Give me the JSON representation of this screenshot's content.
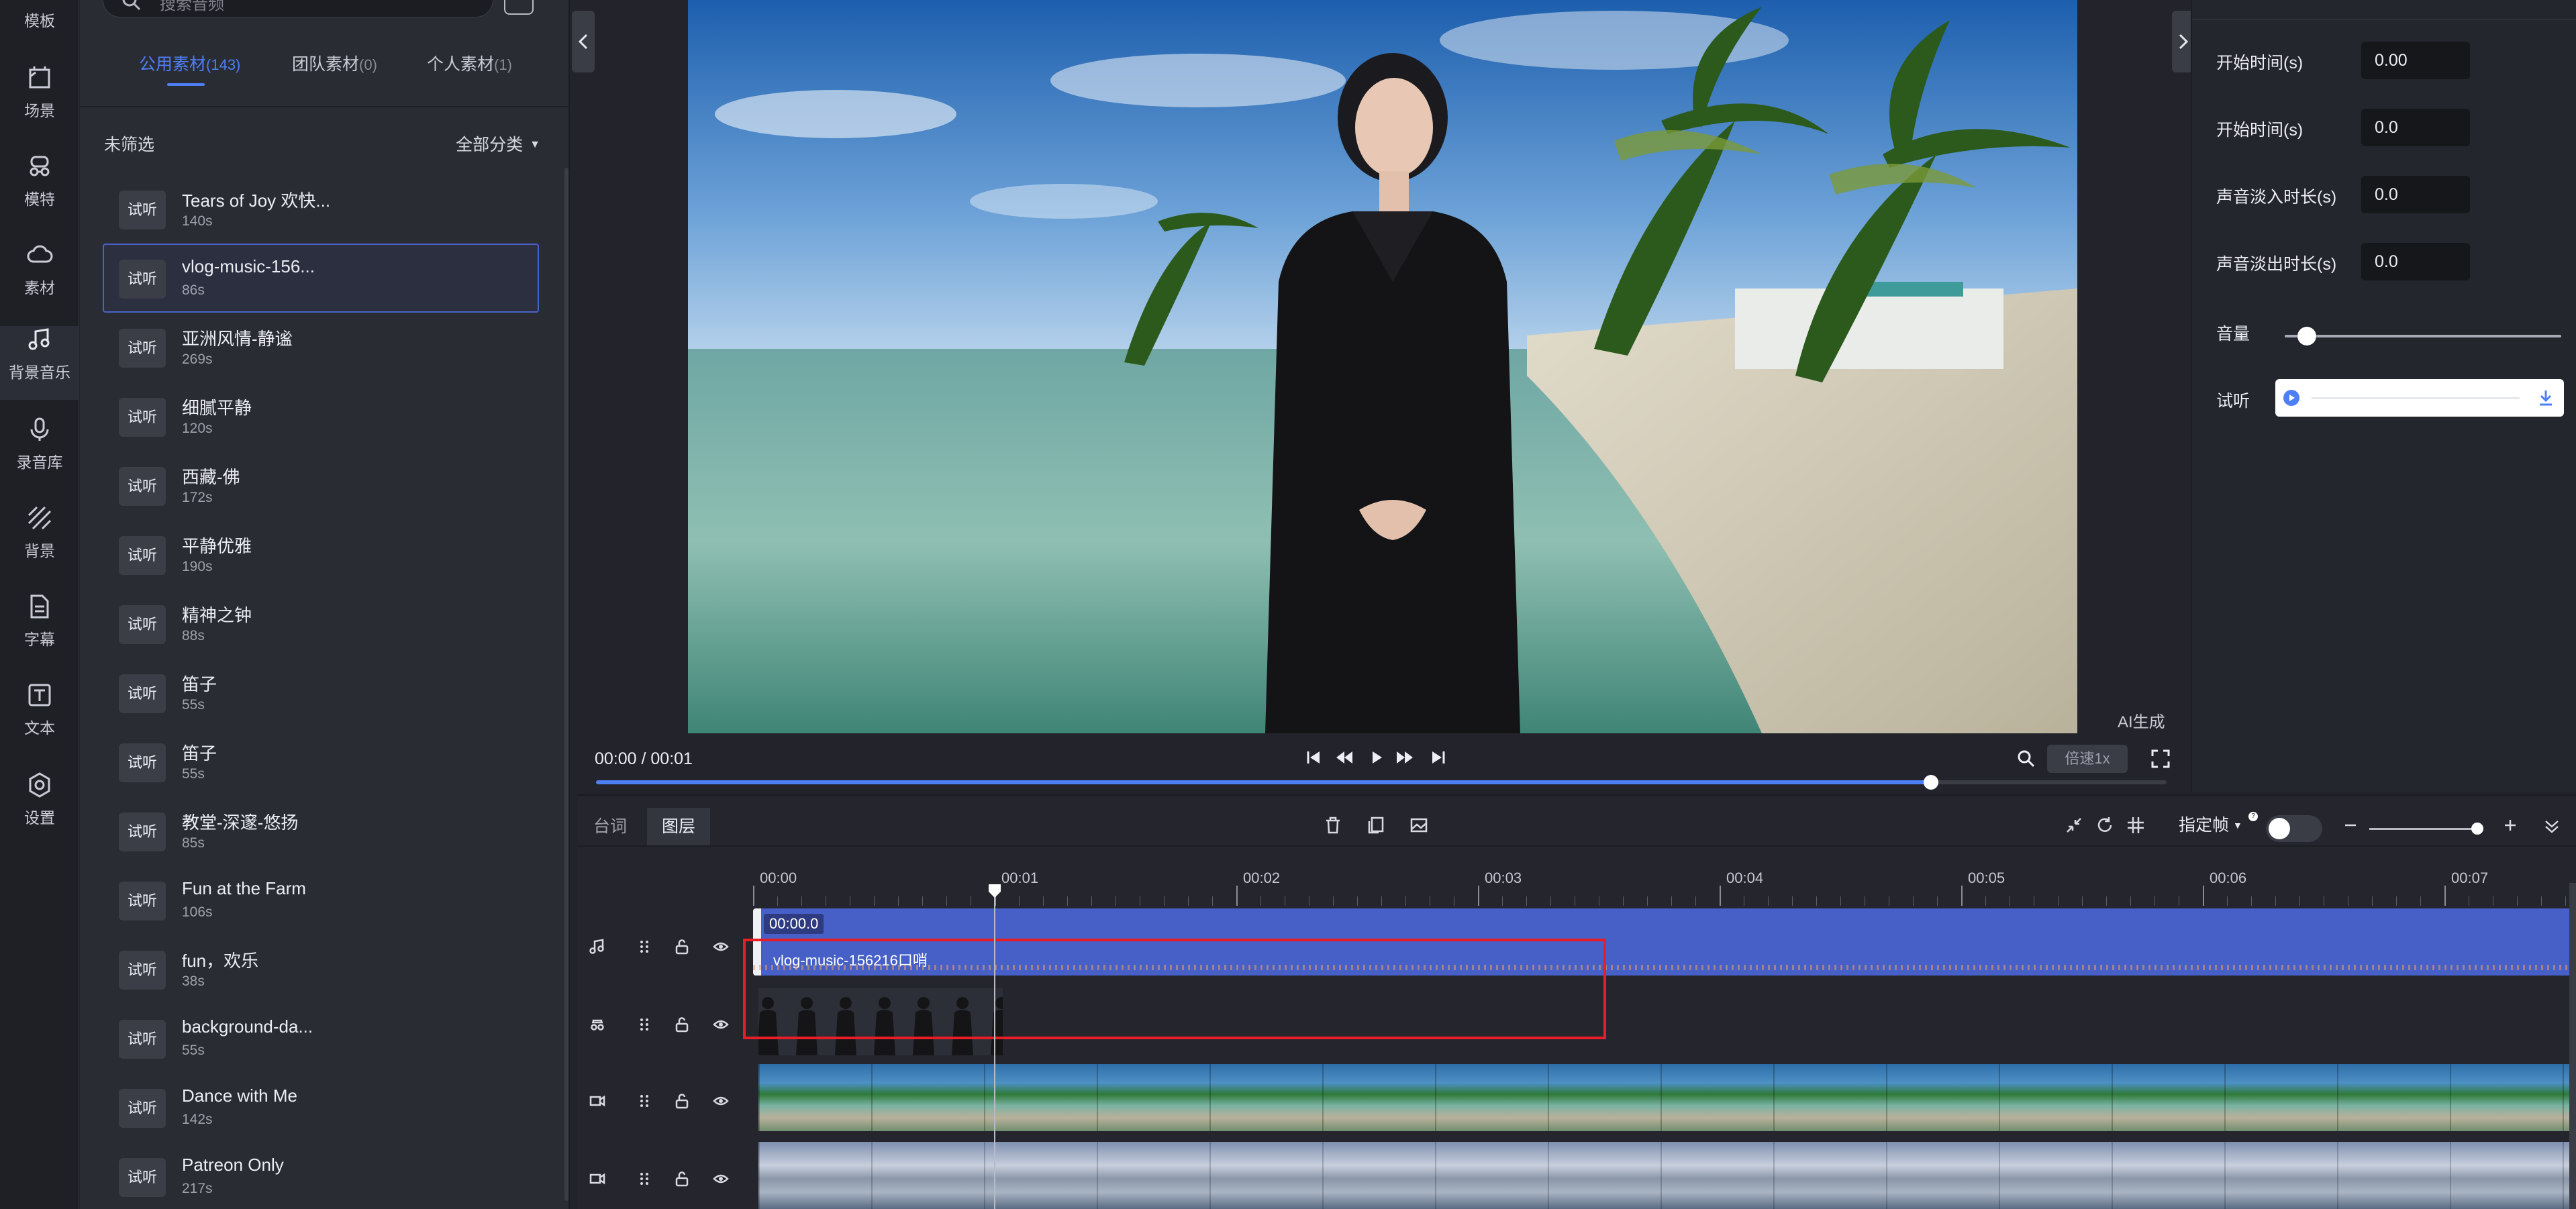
{
  "nav": {
    "items": [
      {
        "label": "模板",
        "icon": "template-icon"
      },
      {
        "label": "场景",
        "icon": "scene-icon"
      },
      {
        "label": "模特",
        "icon": "model-icon"
      },
      {
        "label": "素材",
        "icon": "cloud-icon"
      },
      {
        "label": "背景音乐",
        "icon": "music-note-icon"
      },
      {
        "label": "录音库",
        "icon": "microphone-icon"
      },
      {
        "label": "背景",
        "icon": "diagonal-lines-icon"
      },
      {
        "label": "字幕",
        "icon": "document-icon"
      },
      {
        "label": "文本",
        "icon": "text-box-icon"
      },
      {
        "label": "设置",
        "icon": "settings-gear-icon"
      }
    ]
  },
  "library": {
    "search_placeholder": "搜索音频",
    "tabs": [
      {
        "label": "公用素材",
        "count": "(143)"
      },
      {
        "label": "团队素材",
        "count": "(0)"
      },
      {
        "label": "个人素材",
        "count": "(1)"
      }
    ],
    "filter_label": "未筛选",
    "category": "全部分类",
    "preview_label": "试听",
    "items": [
      {
        "title": "Tears of Joy 欢快...",
        "duration": "140s"
      },
      {
        "title": "vlog-music-156...",
        "duration": "86s"
      },
      {
        "title": "亚洲风情-静谧",
        "duration": "269s"
      },
      {
        "title": "细腻平静",
        "duration": "120s"
      },
      {
        "title": "西藏-佛",
        "duration": "172s"
      },
      {
        "title": "平静优雅",
        "duration": "190s"
      },
      {
        "title": "精神之钟",
        "duration": "88s"
      },
      {
        "title": "笛子",
        "duration": "55s"
      },
      {
        "title": "笛子",
        "duration": "55s"
      },
      {
        "title": "教堂-深邃-悠扬",
        "duration": "85s"
      },
      {
        "title": "Fun at the Farm",
        "duration": "106s"
      },
      {
        "title": "fun，欢乐",
        "duration": "38s"
      },
      {
        "title": "background-da...",
        "duration": "55s"
      },
      {
        "title": "Dance with Me",
        "duration": "142s"
      },
      {
        "title": "Patreon Only",
        "duration": "217s"
      }
    ]
  },
  "preview": {
    "ai_tag": "AI生成",
    "time_display": "00:00 / 00:01",
    "speed_label": "倍速1x",
    "progress": 0.85
  },
  "properties": {
    "fields": [
      {
        "label": "开始时间(s)",
        "value": "0.00"
      },
      {
        "label": "开始时间(s)",
        "value": "0.0"
      },
      {
        "label": "声音淡入时长(s)",
        "value": "0.0"
      },
      {
        "label": "声音淡出时长(s)",
        "value": "0.0"
      }
    ],
    "volume_label": "音量",
    "volume_level": 0.08,
    "preview_label": "试听"
  },
  "timeline": {
    "tabs": [
      "台词",
      "图层"
    ],
    "keyframe_label": "指定帧",
    "help_mark": "?",
    "ruler": [
      "00:00",
      "00:01",
      "00:02",
      "00:03",
      "00:04",
      "00:05",
      "00:06",
      "00:07"
    ],
    "music_clip": {
      "time": "00:00.0",
      "name": "vlog-music-156216口哨"
    }
  },
  "colors": {
    "accent": "#4d7ff5",
    "music_clip": "#4660c8",
    "highlight": "#e81d25"
  }
}
